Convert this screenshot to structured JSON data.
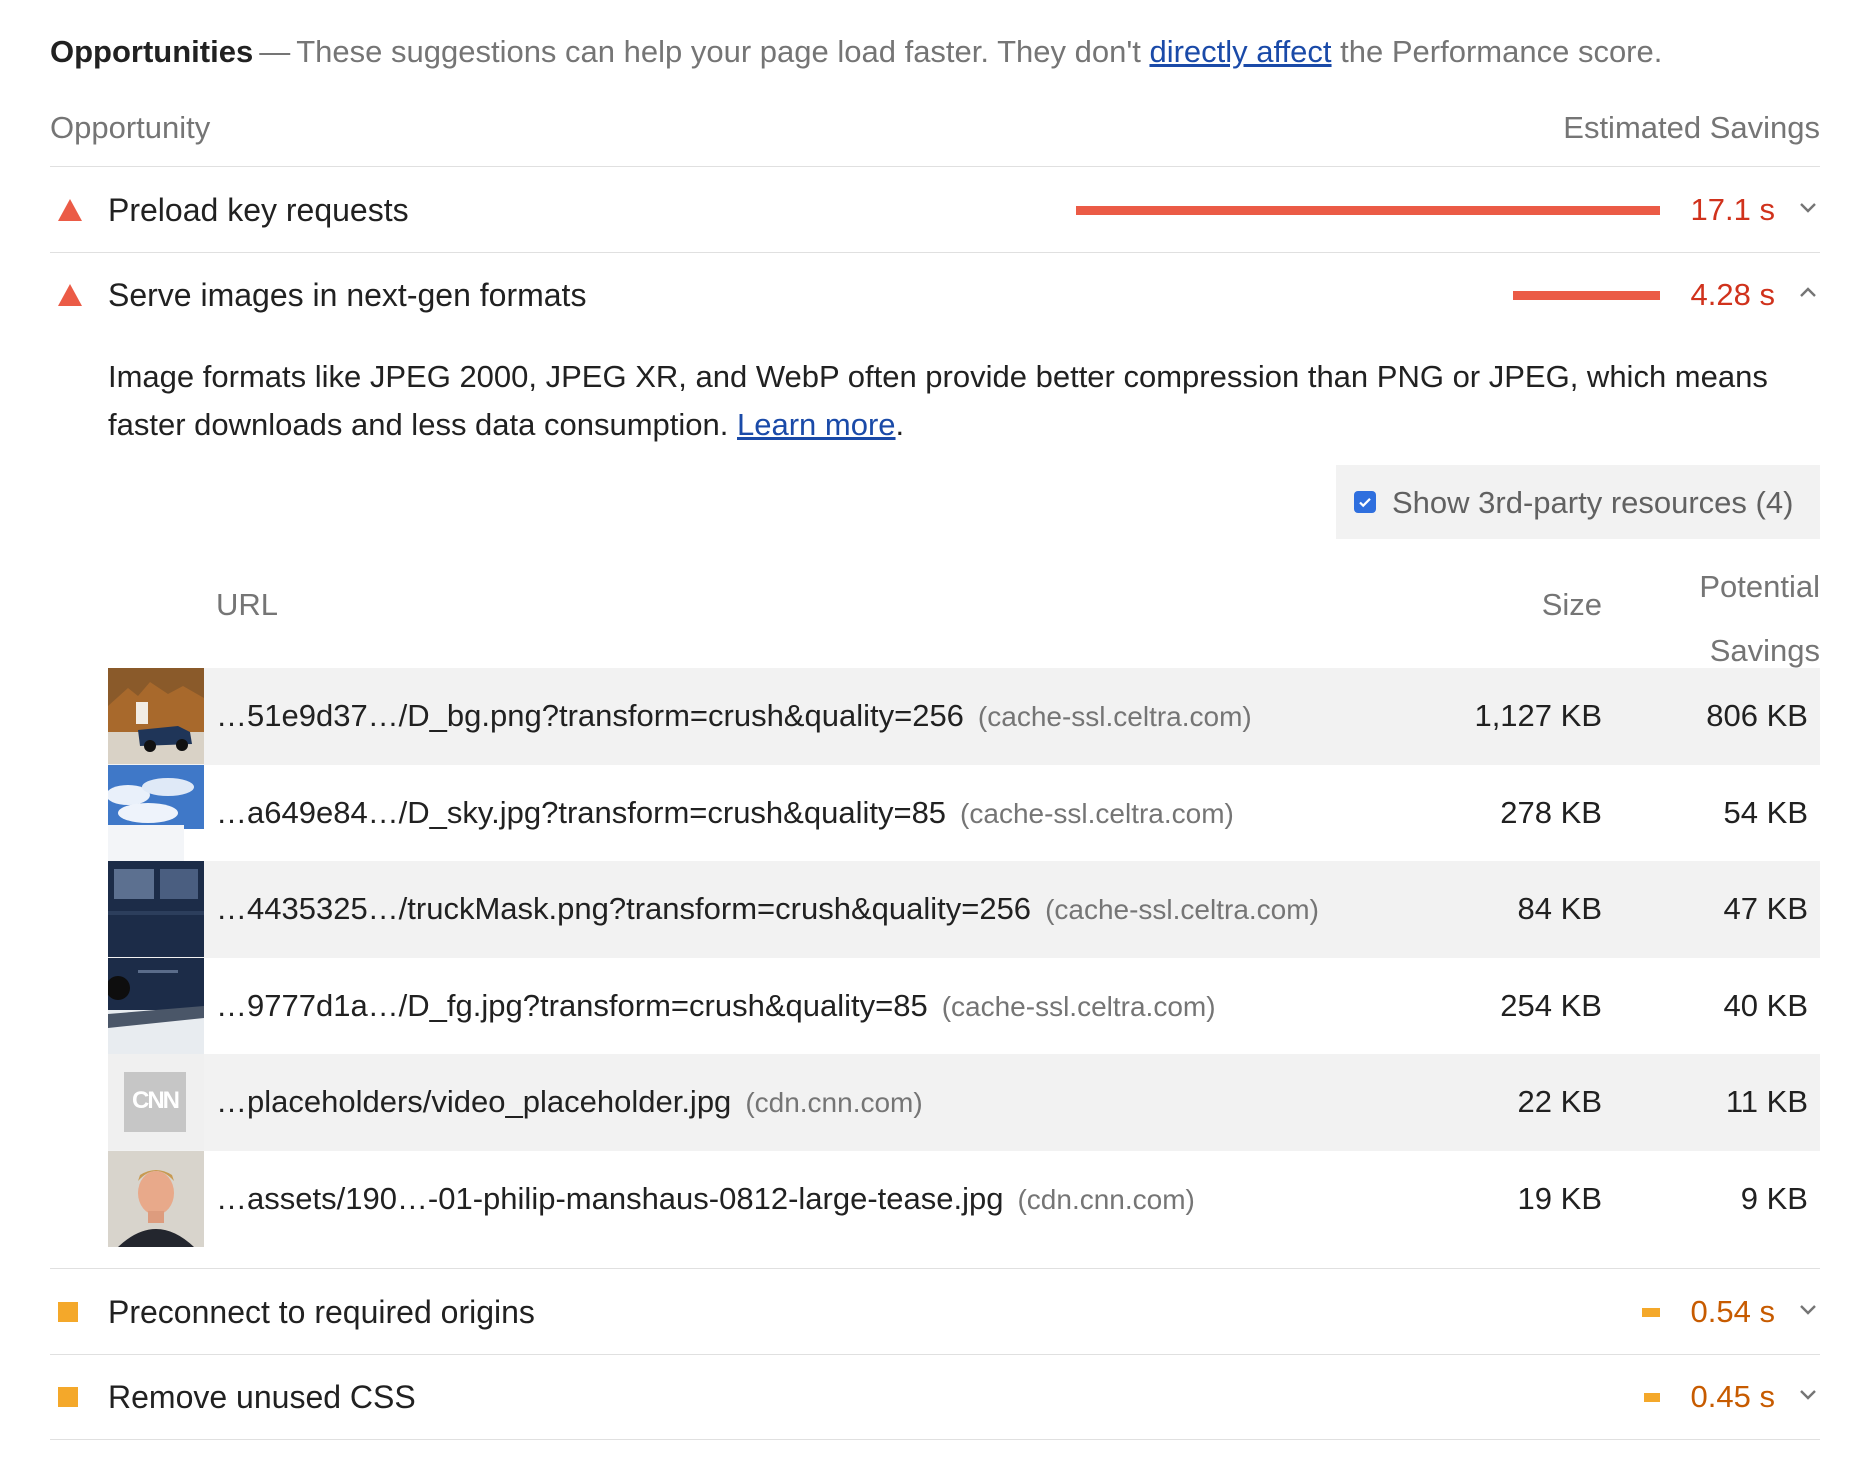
{
  "header": {
    "title": "Opportunities",
    "dash": "—",
    "description_before": "These suggestions can help your page load faster. They don't ",
    "link": "directly affect",
    "description_after": " the Performance score."
  },
  "columns": {
    "left": "Opportunity",
    "right": "Estimated Savings"
  },
  "audits": [
    {
      "name": "Preload key requests",
      "savings": "17.1 s",
      "severity": "fail",
      "bar_fraction": 1.0,
      "expanded": false
    },
    {
      "name": "Serve images in next-gen formats",
      "savings": "4.28 s",
      "severity": "fail",
      "bar_fraction": 0.25,
      "expanded": true
    },
    {
      "name": "Preconnect to required origins",
      "savings": "0.54 s",
      "severity": "average",
      "bar_fraction": 0.03,
      "expanded": false
    },
    {
      "name": "Remove unused CSS",
      "savings": "0.45 s",
      "severity": "average",
      "bar_fraction": 0.03,
      "expanded": false
    }
  ],
  "details": {
    "description": "Image formats like JPEG 2000, JPEG XR, and WebP often provide better compression than PNG or JPEG, which means faster downloads and less data consumption. ",
    "learn_more": "Learn more",
    "period": ".",
    "third_party": {
      "label": "Show 3rd-party resources (4)",
      "checked": true
    },
    "table_headers": {
      "url": "URL",
      "size": "Size",
      "potential_1": "Potential",
      "potential_2": "Savings"
    },
    "rows": [
      {
        "url": "…51e9d37…/D_bg.png?transform=crush&quality=256",
        "domain": "(cache-ssl.celtra.com)",
        "size": "1,127 KB",
        "savings": "806 KB",
        "thumb": "desert-truck-thumb"
      },
      {
        "url": "…a649e84…/D_sky.jpg?transform=crush&quality=85",
        "domain": "(cache-ssl.celtra.com)",
        "size": "278 KB",
        "savings": "54 KB",
        "thumb": "sky-thumb"
      },
      {
        "url": "…4435325…/truckMask.png?transform=crush&quality=256",
        "domain": "(cache-ssl.celtra.com)",
        "size": "84 KB",
        "savings": "47 KB",
        "thumb": "truck-mask-thumb"
      },
      {
        "url": "…9777d1a…/D_fg.jpg?transform=crush&quality=85",
        "domain": "(cache-ssl.celtra.com)",
        "size": "254 KB",
        "savings": "40 KB",
        "thumb": "truck-fg-thumb"
      },
      {
        "url": "…placeholders/video_placeholder.jpg",
        "domain": "(cdn.cnn.com)",
        "size": "22 KB",
        "savings": "11 KB",
        "thumb": "cnn-logo-thumb",
        "thumb_text": "CNN"
      },
      {
        "url": "…assets/190…-01-philip-manshaus-0812-large-tease.jpg",
        "domain": "(cdn.cnn.com)",
        "size": "19 KB",
        "savings": "9 KB",
        "thumb": "portrait-thumb"
      }
    ]
  },
  "colors": {
    "fail": "#eb5b46",
    "fail_text": "#d0321c",
    "average": "#f4a82a",
    "average_text": "#c75b00",
    "link": "#1a4aa8"
  }
}
